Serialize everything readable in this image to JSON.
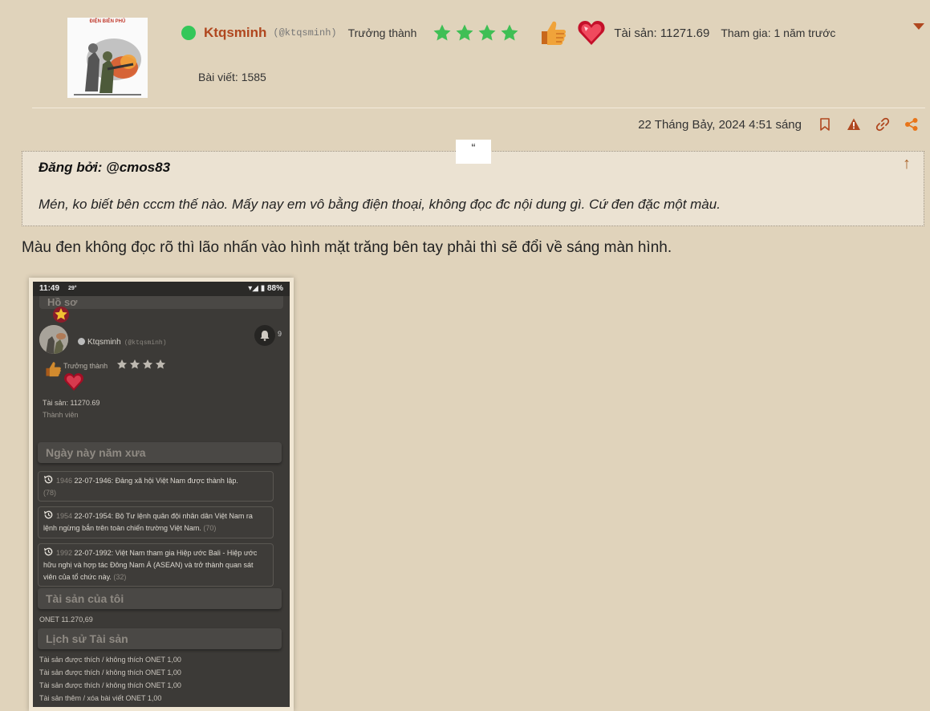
{
  "user": {
    "avatar_text": "ĐIỆN BIÊN PHỦ",
    "username": "Ktqsminh",
    "handle": "(@ktqsminh)",
    "rank": "Trưởng thành",
    "stars": 4,
    "assets": "Tài sản: 11271.69",
    "joined": "Tham gia: 1 năm trước",
    "posts": "Bài viết: 1585",
    "online_color": "#34c759",
    "name_color": "#b0471f"
  },
  "post": {
    "date": "22 Tháng Bảy, 2024 4:51 sáng",
    "icons": [
      "bookmark-icon",
      "report-icon",
      "link-icon",
      "share-icon"
    ],
    "accent_color": "#e8751a"
  },
  "quote": {
    "mark": "“",
    "author": "Đăng bởi: @cmos83",
    "text": "Mén, ko biết bên cccm thế nào. Mấy nay em vô bằng điện thoại, không đọc đc nội dung gì. Cứ đen đặc một màu.",
    "up_arrow": "↑"
  },
  "reply": {
    "text": "Màu đen không đọc rõ thì lão nhấn vào hình mặt trăng bên tay phải thì sẽ đổi về sáng màn hình."
  },
  "screenshot": {
    "time": "11:49",
    "weather": "29°",
    "battery": "▾◢ ▮ 88%",
    "header": "Hồ sơ",
    "username": "Ktqsminh",
    "handle": "(@ktqsminh)",
    "bell_count": "9",
    "rank": "Trưởng thành",
    "asset": "Tài sản: 11270.69",
    "role": "Thành viên",
    "section_history": "Ngày này năm xưa",
    "events": [
      {
        "year": "1946",
        "text": "22-07-1946: Đảng xã hội Việt Nam được thành lập.",
        "count": "(78)"
      },
      {
        "year": "1954",
        "text": "22-07-1954: Bộ Tư lệnh quân đội nhân dân Việt Nam ra lệnh ngừng bắn trên toàn chiến trường Việt Nam.",
        "count": "(70)"
      },
      {
        "year": "1992",
        "text": "22-07-1992: Việt Nam tham gia Hiệp ước Bali - Hiệp ước hữu nghị và hợp tác Đông Nam Á (ASEAN) và trở thành quan sát viên của tổ chức này.",
        "count": "(32)"
      }
    ],
    "section_assets": "Tài sản của tôi",
    "onet": "ONET 11.270,69",
    "section_asset_history": "Lịch sử Tài sản",
    "history": [
      "Tài sản được thích / không thích ONET 1,00",
      "Tài sản được thích / không thích ONET 1,00",
      "Tài sản được thích / không thích ONET 1,00",
      "Tài sản thêm / xóa bài viết ONET 1,00"
    ]
  }
}
